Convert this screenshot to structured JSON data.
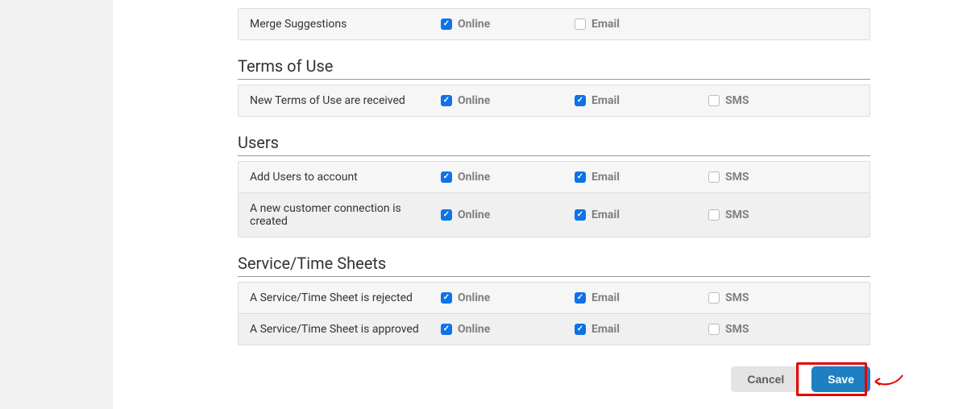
{
  "labels": {
    "online": "Online",
    "email": "Email",
    "sms": "SMS"
  },
  "sections": [
    {
      "title": null,
      "rows": [
        {
          "label": "Merge Suggestions",
          "online": true,
          "email": false,
          "sms": null
        }
      ]
    },
    {
      "title": "Terms of Use",
      "rows": [
        {
          "label": "New Terms of Use are received",
          "online": true,
          "email": true,
          "sms": false
        }
      ]
    },
    {
      "title": "Users",
      "rows": [
        {
          "label": "Add Users to account",
          "online": true,
          "email": true,
          "sms": false
        },
        {
          "label": "A new customer connection is created",
          "online": true,
          "email": true,
          "sms": false
        }
      ]
    },
    {
      "title": "Service/Time Sheets",
      "rows": [
        {
          "label": "A Service/Time Sheet is rejected",
          "online": true,
          "email": true,
          "sms": false
        },
        {
          "label": "A Service/Time Sheet is approved",
          "online": true,
          "email": true,
          "sms": false
        }
      ]
    }
  ],
  "buttons": {
    "cancel": "Cancel",
    "save": "Save"
  }
}
